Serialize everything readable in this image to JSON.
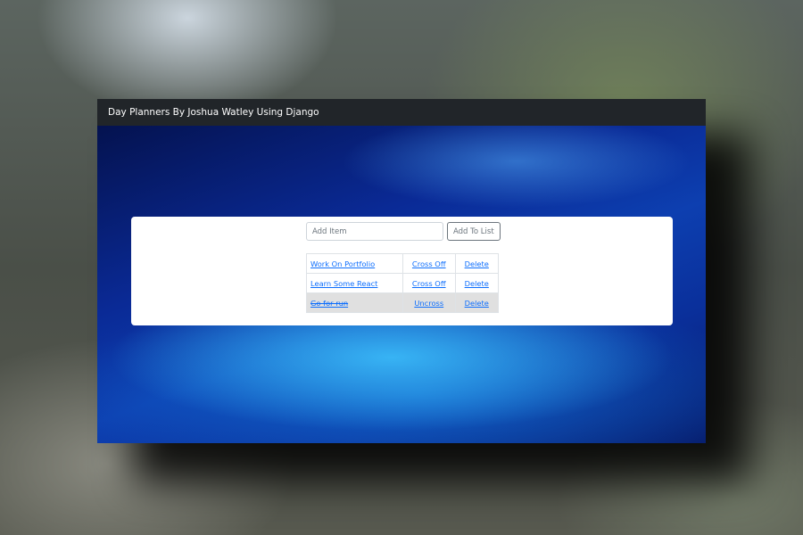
{
  "navbar": {
    "brand": "Day Planners By Joshua Watley Using Django"
  },
  "form": {
    "input_placeholder": "Add Item",
    "input_value": "",
    "submit_label": "Add To List"
  },
  "items": [
    {
      "title": "Work On Portfolio",
      "action": "Cross Off",
      "delete": "Delete",
      "completed": false
    },
    {
      "title": "Learn Some React",
      "action": "Cross Off",
      "delete": "Delete",
      "completed": false
    },
    {
      "title": "Go for run",
      "action": "Uncross",
      "delete": "Delete",
      "completed": true
    }
  ],
  "colors": {
    "navbar_bg": "#212529",
    "link": "#0d6efd",
    "completed_row_bg": "#e0e0e0"
  }
}
